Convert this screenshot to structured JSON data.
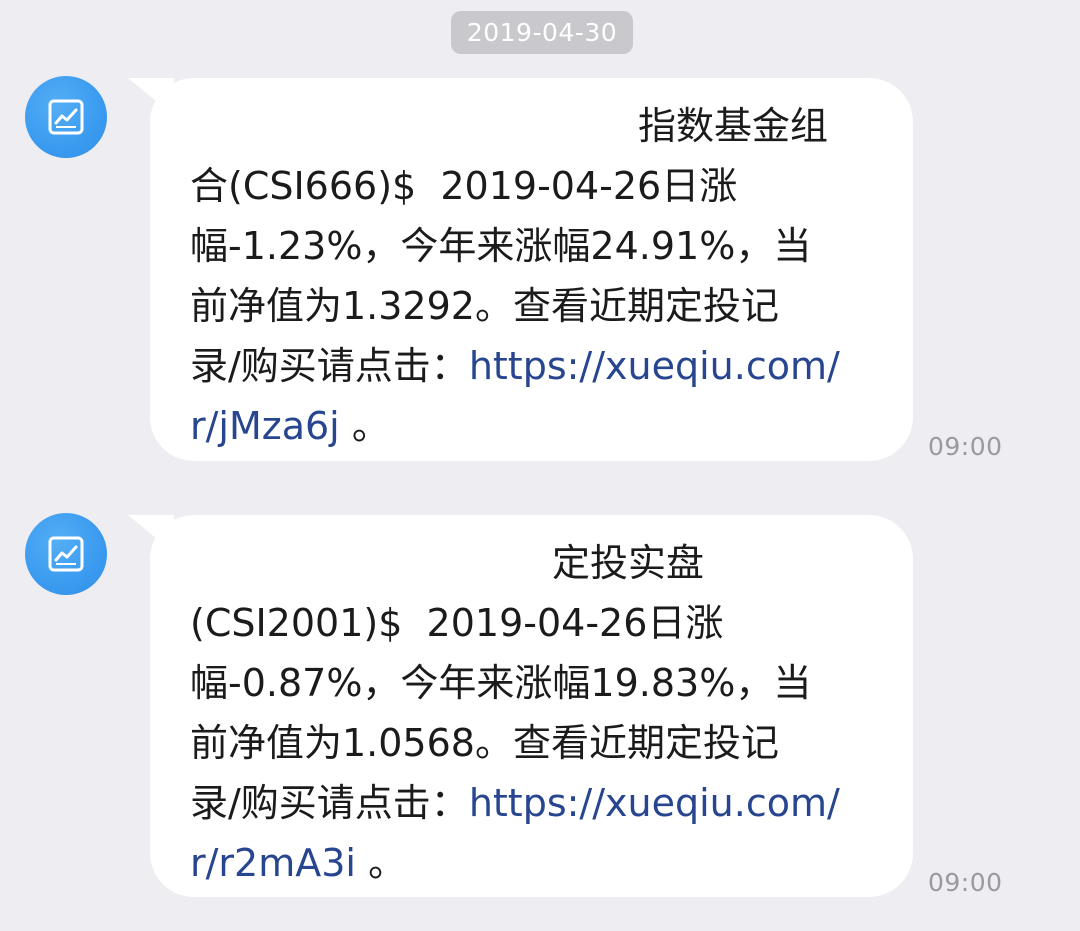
{
  "date_separator": "2019-04-30",
  "messages": [
    {
      "avatar_icon": "line-chart-icon",
      "line1": "指数基金组",
      "line2": "合(CSI666)$  2019-04-26日涨",
      "line3": "幅-1.23%，今年来涨幅24.91%，当",
      "line4": "前净值为1.3292。查看近期定投记",
      "line5_prefix": "录/购买请点击：",
      "link_part1": "https://xueqiu.com/",
      "link_part2": "r/jMza6j",
      "line6_suffix": " 。",
      "time": "09:00"
    },
    {
      "avatar_icon": "line-chart-icon",
      "line1": "定投实盘",
      "line2": "(CSI2001)$  2019-04-26日涨",
      "line3": "幅-0.87%，今年来涨幅19.83%，当",
      "line4": "前净值为1.0568。查看近期定投记",
      "line5_prefix": "录/购买请点击：",
      "link_part1": "https://xueqiu.com/",
      "link_part2": "r/r2mA3i",
      "line6_suffix": " 。",
      "time": "09:00"
    }
  ],
  "colors": {
    "background": "#eeedf2",
    "bubble": "#ffffff",
    "avatar": "#3c9cf0",
    "link": "#27468f",
    "text": "#1b1b1b",
    "timestamp": "#999aa0",
    "date_pill": "#c8c8cd"
  }
}
